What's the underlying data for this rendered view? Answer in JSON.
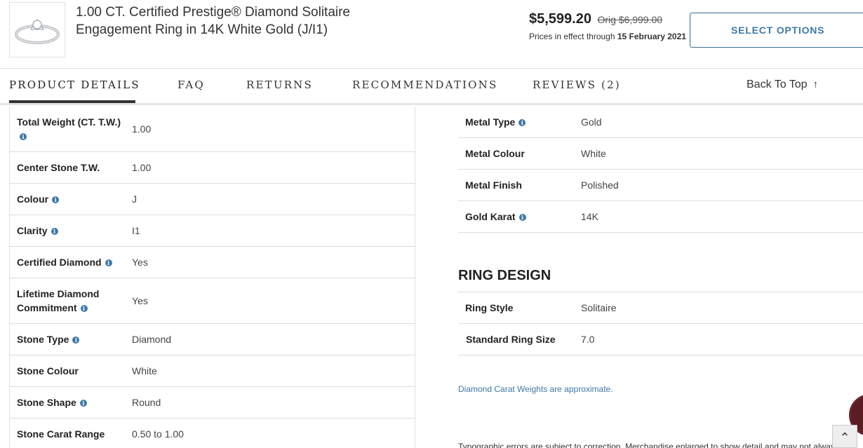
{
  "product": {
    "title": "1.00 CT. Certified Prestige® Diamond Solitaire Engagement Ring in 14K White Gold (J/I1)",
    "price_now": "$5,599.20",
    "price_orig": "Orig $6,999.00",
    "price_note_prefix": "Prices in effect through ",
    "price_note_date": "15 February 2021",
    "select_label": "SELECT OPTIONS"
  },
  "tabs": [
    {
      "label": "PRODUCT DETAILS"
    },
    {
      "label": "FAQ"
    },
    {
      "label": "RETURNS"
    },
    {
      "label": "RECOMMENDATIONS"
    },
    {
      "label": "REVIEWS (2)"
    }
  ],
  "back_to_top": {
    "label": "Back To Top",
    "arrow": "↑"
  },
  "diamond_specs": [
    {
      "label": "Total Weight (CT. T.W.)",
      "value": "1.00"
    },
    {
      "label": "Center Stone T.W.",
      "value": "1.00"
    },
    {
      "label": "Colour",
      "value": "J"
    },
    {
      "label": "Clarity",
      "value": "I1"
    },
    {
      "label": "Certified Diamond",
      "value": "Yes"
    },
    {
      "label": "Lifetime Diamond Commitment",
      "value": "Yes"
    },
    {
      "label": "Stone Type",
      "value": "Diamond"
    },
    {
      "label": "Stone Colour",
      "value": "White"
    },
    {
      "label": "Stone Shape",
      "value": "Round"
    },
    {
      "label": "Stone Carat Range",
      "value": "0.50 to 1.00"
    }
  ],
  "metal_specs": [
    {
      "label": "Metal Type",
      "value": "Gold"
    },
    {
      "label": "Metal Colour",
      "value": "White"
    },
    {
      "label": "Metal Finish",
      "value": "Polished"
    },
    {
      "label": "Gold Karat",
      "value": "14K"
    }
  ],
  "ring_design": {
    "title": "RING DESIGN",
    "rows": [
      {
        "label": "Ring Style",
        "value": "Solitaire"
      },
      {
        "label": "Standard Ring Size",
        "value": "7.0"
      }
    ]
  },
  "disclaimer": "Diamond Carat Weights are approximate.",
  "typo_note": "Typographic errors are subject to correction. Merchandise enlarged to show detail and may not alway",
  "info_glyph": "i",
  "scroll_top_glyph": "⌃",
  "colors": {
    "accent": "#3e79a6",
    "border": "#dddddd"
  }
}
